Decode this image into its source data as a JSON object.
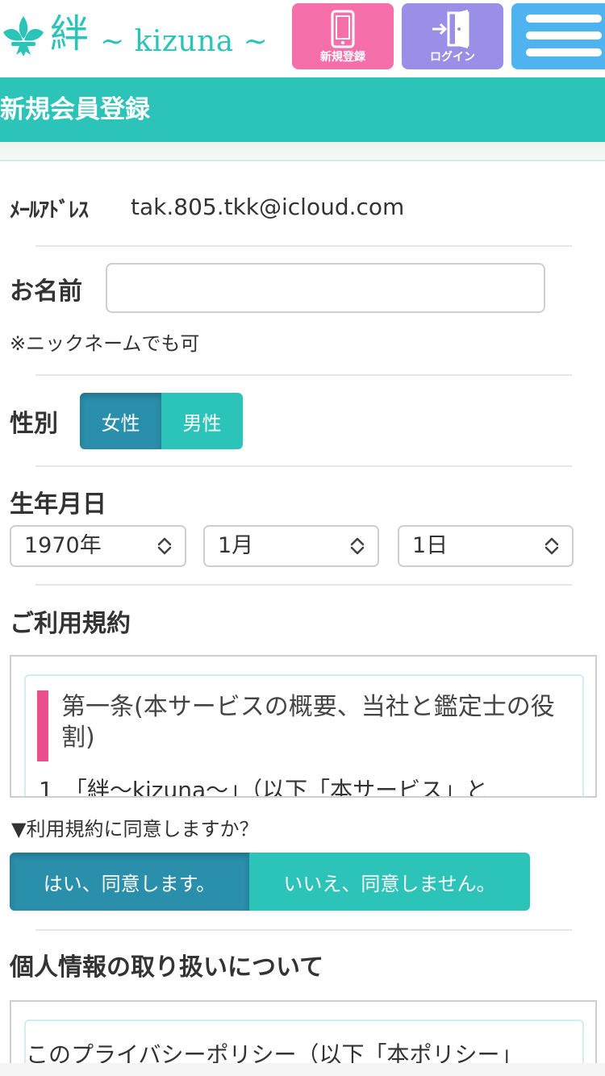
{
  "header": {
    "logo_kanji": "絆",
    "logo_latin": "~ kizuna ~",
    "register_label": "新規登録",
    "login_label": "ログイン",
    "icons": {
      "logo": "fleur-logo-icon",
      "register": "phone-icon",
      "login": "door-login-icon",
      "menu": "hamburger-menu-icon"
    }
  },
  "page": {
    "title": "新規会員登録"
  },
  "form": {
    "email": {
      "label": "ﾒｰﾙｱﾄﾞﾚｽ",
      "value": "tak.805.tkk@icloud.com"
    },
    "name": {
      "label": "お名前",
      "value": "",
      "note": "※ニックネームでも可"
    },
    "gender": {
      "label": "性別",
      "options": [
        "女性",
        "男性"
      ],
      "selected": "女性"
    },
    "birthday": {
      "label": "生年月日",
      "year": "1970年",
      "month": "1月",
      "day": "1日"
    },
    "terms": {
      "label": "ご利用規約",
      "heading": "第一条(本サービスの概要、当社と鑑定士の役割)",
      "text": "1　「絆～kizuna～」（以下「本サービス」と",
      "question": "▼利用規約に同意しますか？",
      "agree": "はい、同意します。",
      "disagree": "いいえ、同意しません。",
      "selected": "はい、同意します。"
    },
    "privacy": {
      "label": "個人情報の取り扱いについて",
      "text": "このプライバシーポリシー（以下「本ポリシー」"
    }
  },
  "colors": {
    "teal": "#2cc3b8",
    "dark_teal": "#2a8fab",
    "pink": "#f56faa",
    "purple": "#9b8ee6",
    "blue": "#4fb3f0",
    "accent_bar": "#ea4f8d"
  }
}
